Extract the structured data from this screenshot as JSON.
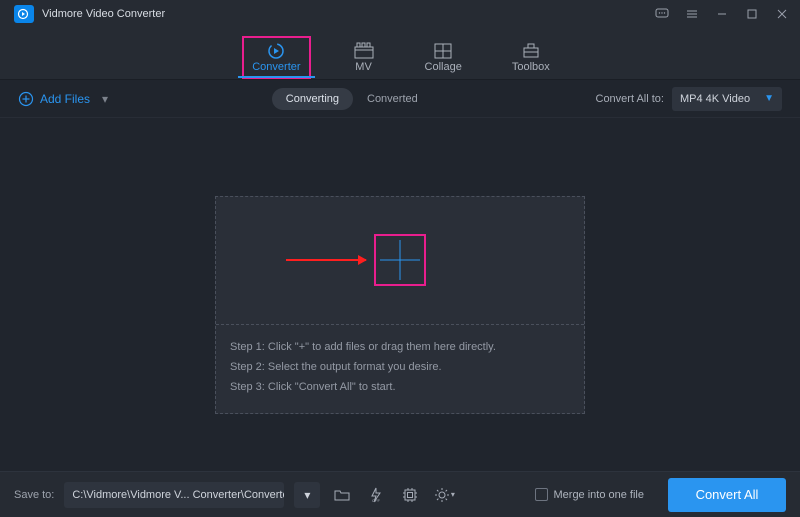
{
  "app": {
    "title": "Vidmore Video Converter"
  },
  "tabs": {
    "converter": "Converter",
    "mv": "MV",
    "collage": "Collage",
    "toolbox": "Toolbox"
  },
  "toolbar": {
    "add_files": "Add Files",
    "converting": "Converting",
    "converted": "Converted",
    "convert_all_to": "Convert All to:",
    "format_value": "MP4 4K Video"
  },
  "dropzone": {
    "step1": "Step 1: Click \"+\" to add files or drag them here directly.",
    "step2": "Step 2: Select the output format you desire.",
    "step3": "Step 3: Click \"Convert All\" to start."
  },
  "bottom": {
    "save_to": "Save to:",
    "path": "C:\\Vidmore\\Vidmore V... Converter\\Converted",
    "merge": "Merge into one file",
    "convert_all": "Convert All"
  }
}
